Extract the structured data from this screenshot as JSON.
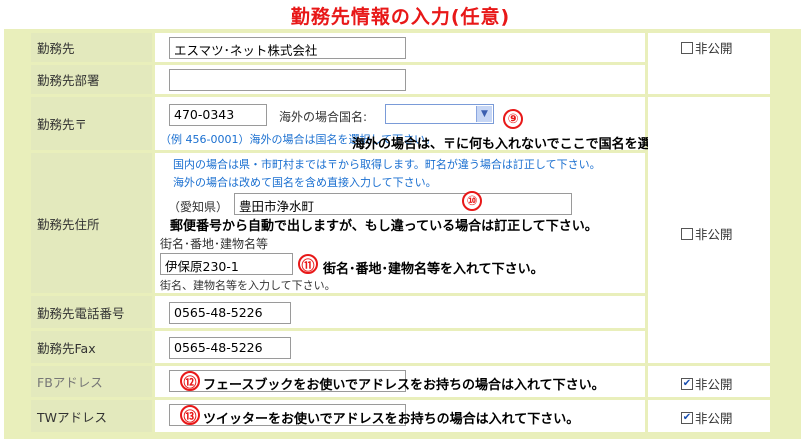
{
  "title": "勤務先情報の入力(任意)",
  "rows": {
    "company": {
      "label": "勤務先",
      "value": "エスマツ･ネット株式会社"
    },
    "department": {
      "label": "勤務先部署",
      "value": ""
    },
    "postal": {
      "label": "勤務先〒",
      "value": "470-0343",
      "country_label": "海外の場合国名:",
      "country_value": "",
      "example": "（例 456-0001）海外の場合は国名を選択して下さい。"
    },
    "address": {
      "label": "勤務先住所",
      "note1": "国内の場合は県・市町村までは〒から取得します。町名が違う場合は訂正して下さい。",
      "note2": "海外の場合は改めて国名を含め直接入力して下さい。",
      "prefecture": "（愛知県）",
      "city_value": "豊田市浄水町",
      "street_label": "街名･番地･建物名等",
      "street_value": "伊保原230-1",
      "street_hint": "街名、建物名等を入力して下さい。"
    },
    "phone": {
      "label": "勤務先電話番号",
      "value": "0565-48-5226"
    },
    "fax": {
      "label": "勤務先Fax",
      "value": "0565-48-5226"
    },
    "fb": {
      "label": "FBアドレス",
      "value": ""
    },
    "tw": {
      "label": "TWアドレス",
      "value": ""
    }
  },
  "privacy": {
    "label": "非公開",
    "company_checked": false,
    "address_checked": false,
    "fb_checked": true,
    "tw_checked": true
  },
  "annotations": {
    "n9": {
      "num": "⑨",
      "text": "海外の場合は、〒に何も入れないでここで国名を選択して下さい。"
    },
    "n10": {
      "num": "⑩",
      "text": "郵便番号から自動で出しますが、もし違っている場合は訂正して下さい。"
    },
    "n11": {
      "num": "⑪",
      "text": "街名･番地･建物名等を入れて下さい。"
    },
    "n12": {
      "num": "⑫",
      "text": "フェースブックをお使いでアドレスをお持ちの場合は入れて下さい。"
    },
    "n13": {
      "num": "⑬",
      "text": "ツイッターをお使いでアドレスをお持ちの場合は入れて下さい。"
    }
  },
  "colors": {
    "title": "#e81818",
    "frame": "#e9efbb",
    "label_bg": "#e3e9bd",
    "note_blue": "#1a6fd0"
  }
}
